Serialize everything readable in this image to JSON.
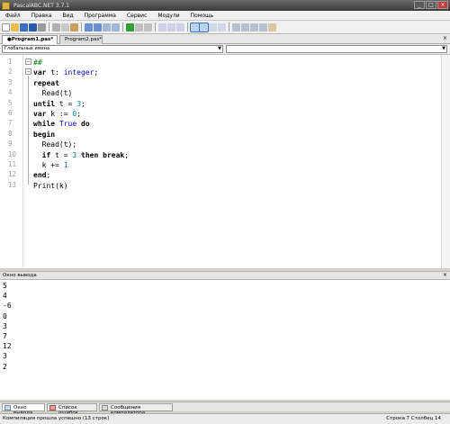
{
  "window": {
    "title": "PascalABC.NET 3.7.1"
  },
  "menu": [
    "Файл",
    "Правка",
    "Вид",
    "Программа",
    "Сервис",
    "Модули",
    "Помощь"
  ],
  "tabs": [
    {
      "label": "●Program1.pas*",
      "active": true
    },
    {
      "label": "Program2.pas*",
      "active": false
    }
  ],
  "combo": {
    "scope": "Глобальные имена"
  },
  "code_lines": [
    {
      "n": "1",
      "html": "<span class=\"cm\">##</span>"
    },
    {
      "n": "2",
      "html": "<span class=\"kw\">var</span> t: <span class=\"ty\">integer</span>;"
    },
    {
      "n": "3",
      "html": "<span class=\"kw\">repeat</span>"
    },
    {
      "n": "4",
      "html": "  Read(t)"
    },
    {
      "n": "5",
      "html": "<span class=\"kw\">until</span> t = <span class=\"num\">3</span>;"
    },
    {
      "n": "6",
      "html": "<span class=\"kw\">var</span> k := <span class=\"num\">0</span>;"
    },
    {
      "n": "7",
      "html": "<span class=\"kw\">while</span> <span class=\"ty\">True</span> <span class=\"kw\">do</span>"
    },
    {
      "n": "8",
      "html": "<span class=\"kw\">begin</span>"
    },
    {
      "n": "9",
      "html": "  Read(t);"
    },
    {
      "n": "10",
      "html": "  <span class=\"kw\">if</span> t = <span class=\"num\">3</span> <span class=\"kw\">then</span> <span class=\"kw\">break</span>;"
    },
    {
      "n": "11",
      "html": "  k += <span class=\"num\">1</span>"
    },
    {
      "n": "12",
      "html": "<span class=\"kw\">end</span>;"
    },
    {
      "n": "13",
      "html": "Print(k)"
    }
  ],
  "output": {
    "title": "Окно вывода",
    "lines": [
      "5",
      "4",
      "-6",
      "0",
      "3",
      "7",
      "12",
      "3",
      "2"
    ]
  },
  "bottom_tabs": [
    "Окно вывода",
    "Список ошибок",
    "Сообщения компилятора"
  ],
  "status": {
    "message": "Компиляция прошла успешно (13 строк)",
    "position": "Строка  7  Столбец  14"
  }
}
